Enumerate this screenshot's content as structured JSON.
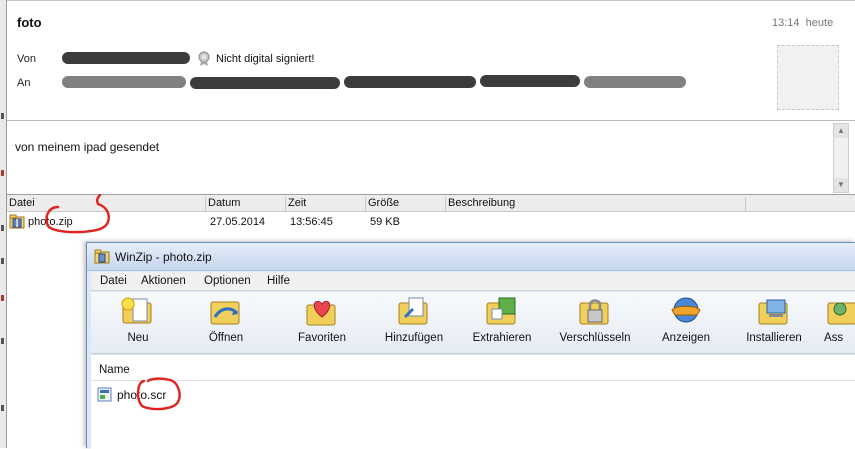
{
  "message": {
    "subject": "foto",
    "time": "13:14",
    "date_label": "heute",
    "from_label": "Von",
    "to_label": "An",
    "signature_status": "Nicht digital signiert!",
    "body": "von meinem ipad gesendet"
  },
  "attachments": {
    "columns": [
      "Datei",
      "Datum",
      "Zeit",
      "Größe",
      "Beschreibung"
    ],
    "rows": [
      {
        "name": "photo.zip",
        "date": "27.05.2014",
        "time": "13:56:45",
        "size": "59 KB",
        "description": ""
      }
    ]
  },
  "winzip": {
    "title": "WinZip - photo.zip",
    "menu": [
      "Datei",
      "Aktionen",
      "Optionen",
      "Hilfe"
    ],
    "toolbar": [
      {
        "label": "Neu",
        "icon": "new-archive-icon"
      },
      {
        "label": "Öffnen",
        "icon": "open-folder-icon"
      },
      {
        "label": "Favoriten",
        "icon": "favorites-heart-icon"
      },
      {
        "label": "Hinzufügen",
        "icon": "add-files-icon"
      },
      {
        "label": "Extrahieren",
        "icon": "extract-icon"
      },
      {
        "label": "Verschlüsseln",
        "icon": "encrypt-lock-icon"
      },
      {
        "label": "Anzeigen",
        "icon": "view-glasses-icon"
      },
      {
        "label": "Installieren",
        "icon": "install-computer-icon"
      },
      {
        "label": "Ass",
        "icon": "assistant-icon"
      }
    ],
    "list_header": "Name",
    "files": [
      {
        "name": "photo.scr"
      }
    ]
  },
  "colors": {
    "annotation": "#e0231e",
    "winzip_frame": "#dbe7f6",
    "toolbar_bg": "#eef2f8"
  }
}
